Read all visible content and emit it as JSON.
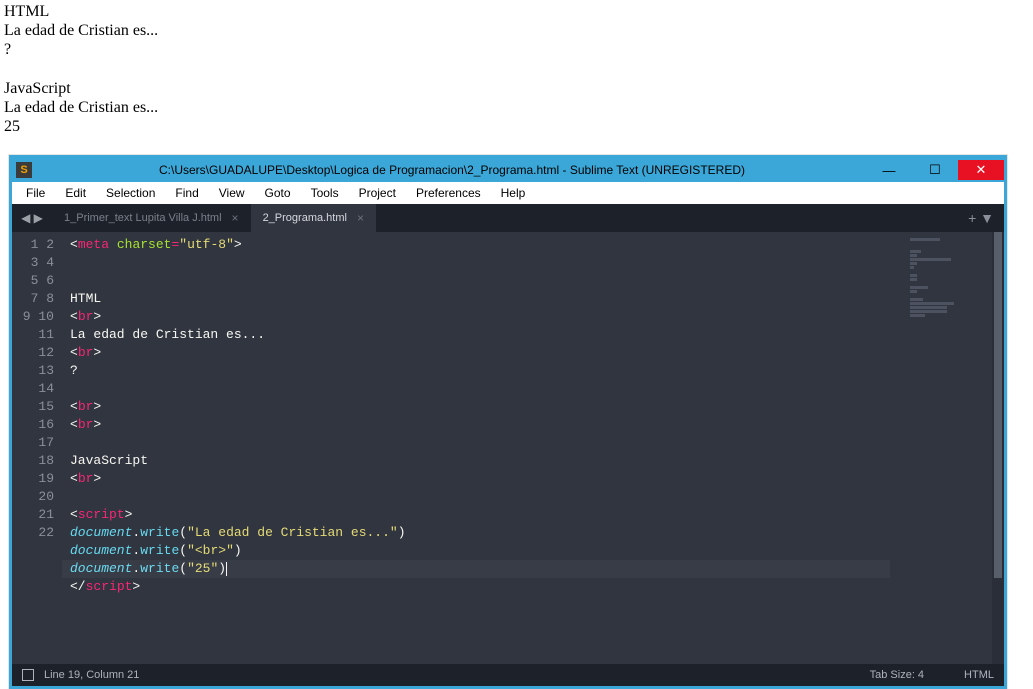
{
  "browser_output": {
    "lines": [
      "HTML",
      "La edad de Cristian es...",
      "?",
      "",
      "JavaScript",
      "La edad de Cristian es...",
      "25"
    ]
  },
  "window": {
    "title": "C:\\Users\\GUADALUPE\\Desktop\\Logica de Programacion\\2_Programa.html - Sublime Text (UNREGISTERED)",
    "app_icon_label": "S"
  },
  "menu": {
    "items": [
      "File",
      "Edit",
      "Selection",
      "Find",
      "View",
      "Goto",
      "Tools",
      "Project",
      "Preferences",
      "Help"
    ]
  },
  "tabs": {
    "left_arrows": "◀ ▶",
    "items": [
      {
        "label": "1_Primer_text Lupita Villa J.html",
        "active": false
      },
      {
        "label": "2_Programa.html",
        "active": true
      }
    ],
    "right_controls": "+  ▼"
  },
  "code": {
    "line_count": 22,
    "highlight_line": 19,
    "lines": {
      "l1": {
        "tag": "meta",
        "attr": "charset",
        "val": "\"utf-8\""
      },
      "l4": "HTML",
      "l5": {
        "tag": "br"
      },
      "l6": "La edad de Cristian es...",
      "l7": {
        "tag": "br"
      },
      "l8": "?",
      "l10": {
        "tag": "br"
      },
      "l11": {
        "tag": "br"
      },
      "l13": "JavaScript",
      "l14": {
        "tag": "br"
      },
      "l16": {
        "tag": "script"
      },
      "l17": {
        "obj": "document",
        "fn": "write",
        "arg": "\"La edad de Cristian es...\""
      },
      "l18": {
        "obj": "document",
        "fn": "write",
        "arg": "\"<br>\""
      },
      "l19": {
        "obj": "document",
        "fn": "write",
        "arg": "\"25\""
      },
      "l20": {
        "close_tag": "script"
      }
    }
  },
  "statusbar": {
    "position": "Line 19, Column 21",
    "tab_size": "Tab Size: 4",
    "syntax": "HTML"
  }
}
